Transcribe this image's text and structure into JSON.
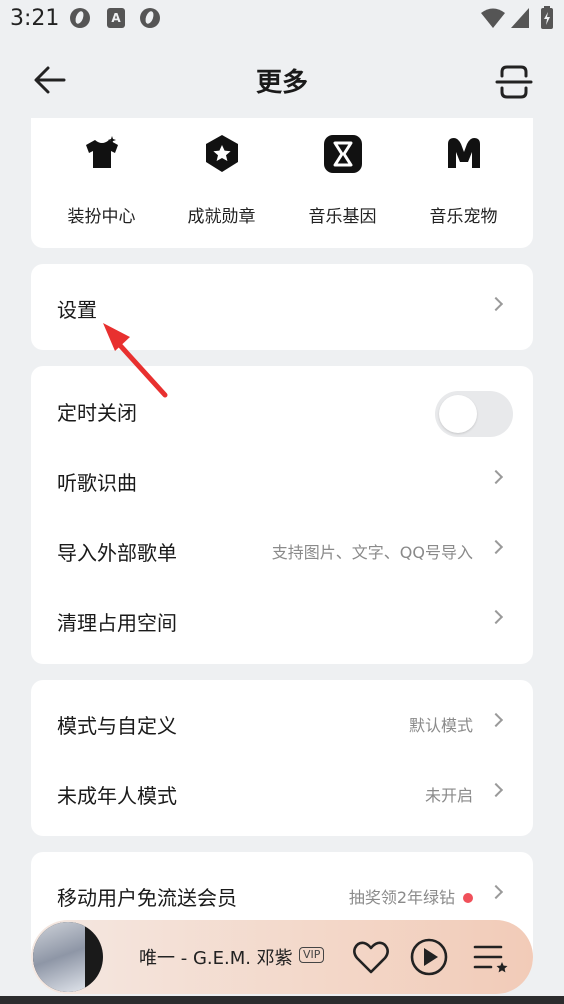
{
  "status_bar": {
    "time": "3:21",
    "a_label": "A"
  },
  "header": {
    "title": "更多"
  },
  "features": [
    {
      "label": "装扮中心",
      "icon": "tshirt-icon"
    },
    {
      "label": "成就勋章",
      "icon": "badge-star-icon"
    },
    {
      "label": "音乐基因",
      "icon": "hourglass-icon"
    },
    {
      "label": "音乐宠物",
      "icon": "m-logo-icon"
    }
  ],
  "settings": {
    "label": "设置"
  },
  "tools": {
    "timer": {
      "label": "定时关闭",
      "enabled": false
    },
    "recognize": {
      "label": "听歌识曲"
    },
    "import": {
      "label": "导入外部歌单",
      "value": "支持图片、文字、QQ号导入"
    },
    "cleanup": {
      "label": "清理占用空间"
    }
  },
  "modes": {
    "custom": {
      "label": "模式与自定义",
      "value": "默认模式"
    },
    "minor": {
      "label": "未成年人模式",
      "value": "未开启"
    }
  },
  "promo": {
    "label": "移动用户免流送会员",
    "value": "抽奖领2年绿钻"
  },
  "player": {
    "song": "唯一 - G.E.M. 邓紫",
    "vip": "VIP"
  },
  "colors": {
    "accent_red": "#f0505a",
    "arrow_red": "#e8302f"
  }
}
